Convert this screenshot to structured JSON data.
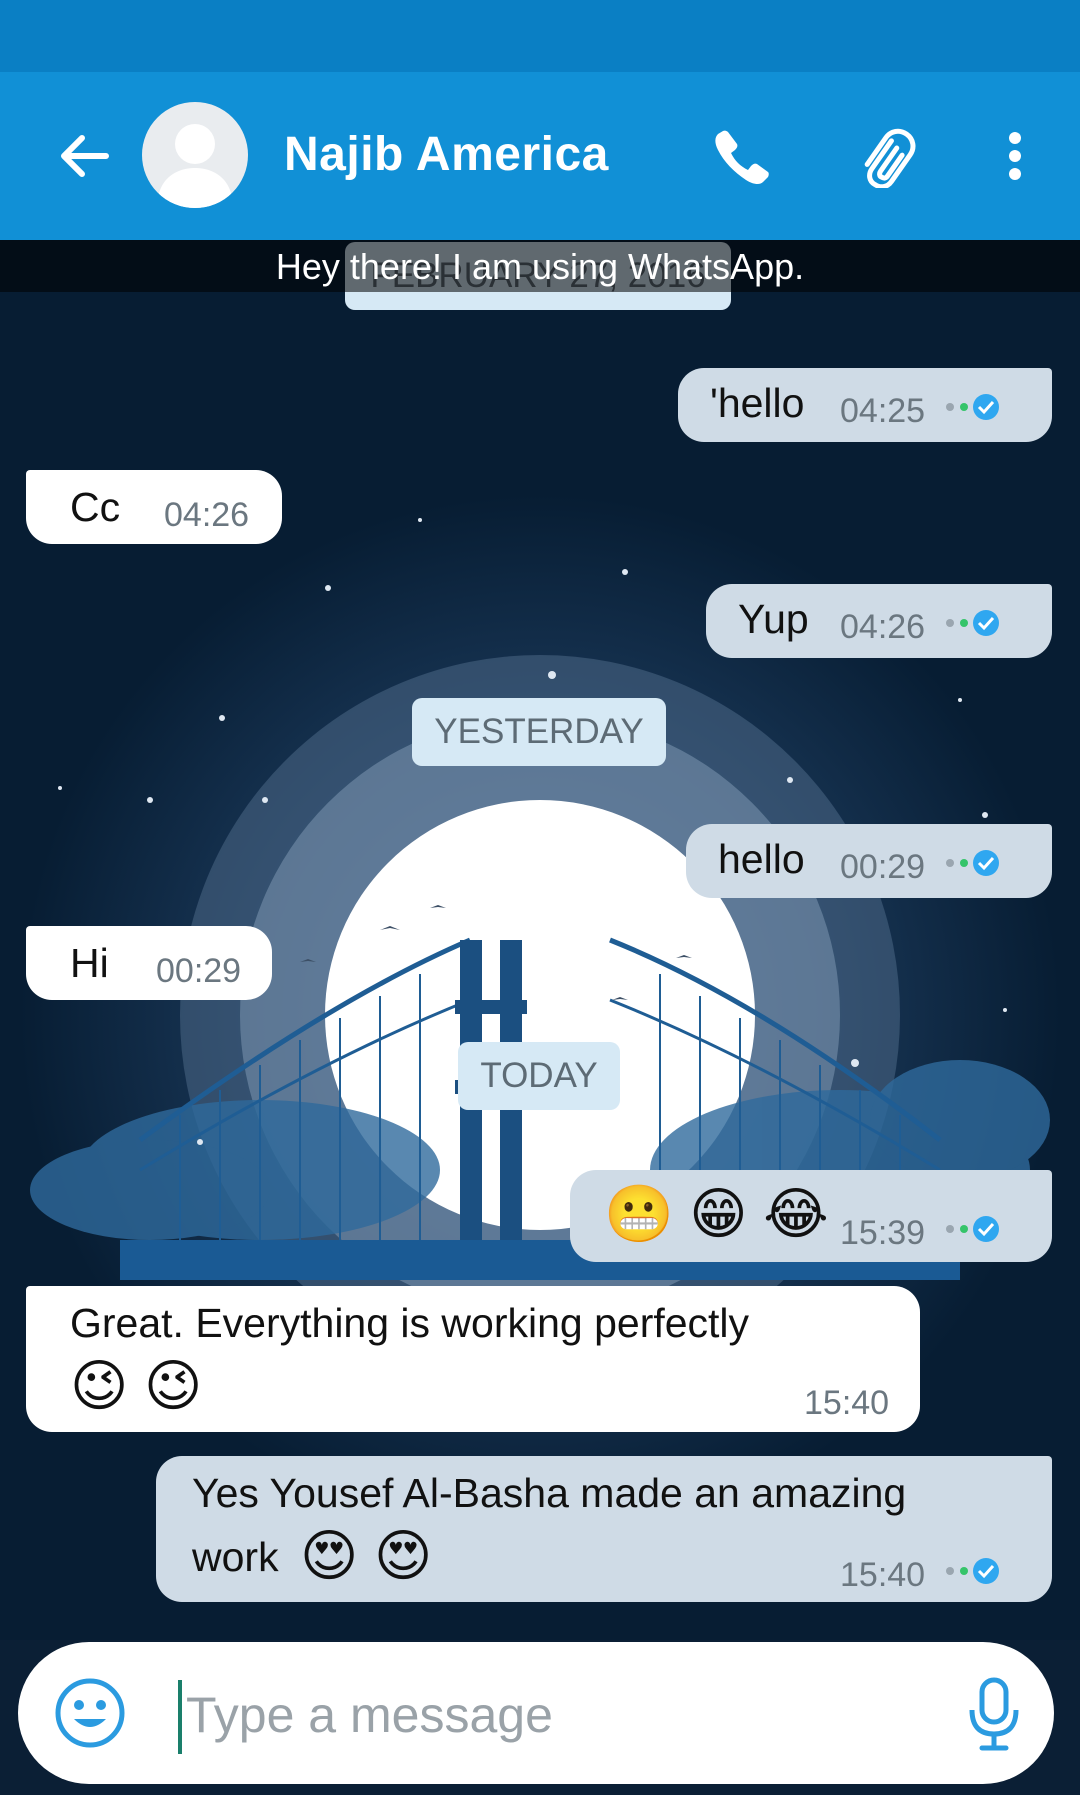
{
  "header": {
    "contact_name": "Najib America",
    "back_icon": "arrow-left-icon",
    "call_icon": "phone-icon",
    "attach_icon": "paperclip-icon",
    "menu_icon": "more-vert-icon",
    "color": "#1190d6"
  },
  "status_line": "Hey there! I am using WhatsApp.",
  "dates": {
    "first": "FEBRUARY 27, 2016",
    "yesterday": "YESTERDAY",
    "today": "TODAY"
  },
  "messages": [
    {
      "direction": "out",
      "text": "'hello",
      "time": "04:25",
      "status": "read"
    },
    {
      "direction": "in",
      "text": "Cc",
      "time": "04:26"
    },
    {
      "direction": "out",
      "text": "Yup",
      "time": "04:26",
      "status": "read"
    },
    {
      "direction": "out",
      "text": "hello",
      "time": "00:29",
      "status": "read"
    },
    {
      "direction": "in",
      "text": "Hi",
      "time": "00:29"
    },
    {
      "direction": "out",
      "text": "😬 😁 😂",
      "time": "15:39",
      "status": "read"
    },
    {
      "direction": "in",
      "text": "Great. Everything is working perfectly",
      "emoji": "😉 😉",
      "time": "15:40"
    },
    {
      "direction": "out",
      "text": "Yes Yousef Al-Basha made an amazing",
      "text2": "work",
      "emoji": "😍 😍",
      "time": "15:40",
      "status": "read"
    }
  ],
  "input": {
    "placeholder": "Type a message",
    "emoji_icon": "emoji-icon",
    "mic_icon": "microphone-icon"
  },
  "colors": {
    "outgoing_bubble": "#cfdbe6",
    "incoming_bubble": "#ffffff",
    "read_tick": "#2fa7f0",
    "delivered_dot": "#35c46a"
  }
}
